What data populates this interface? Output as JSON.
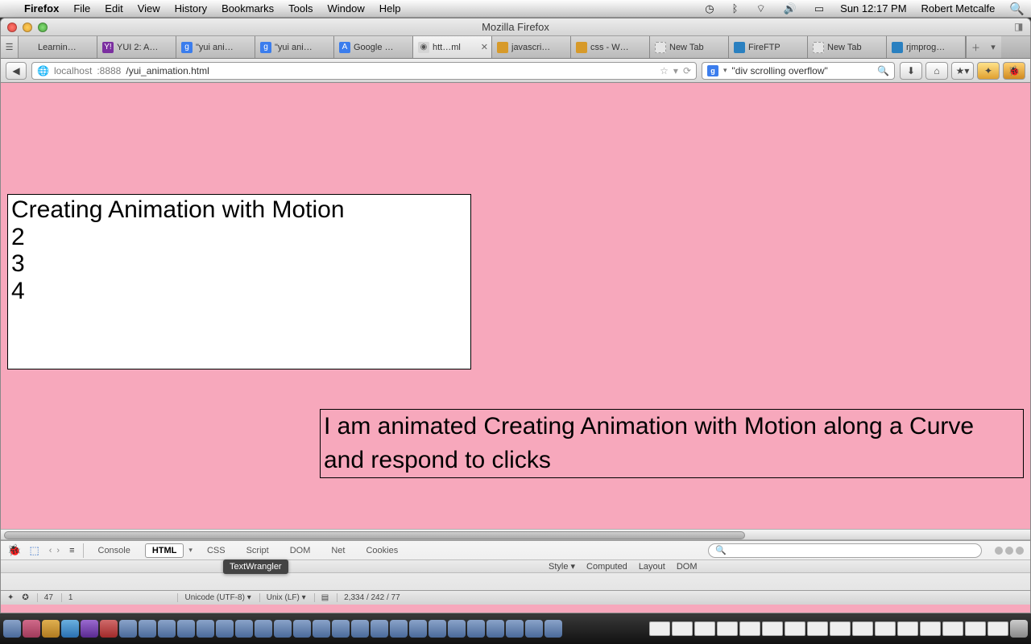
{
  "menubar": {
    "app": "Firefox",
    "items": [
      "File",
      "Edit",
      "View",
      "History",
      "Bookmarks",
      "Tools",
      "Window",
      "Help"
    ],
    "clock": "Sun 12:17 PM",
    "user": "Robert Metcalfe"
  },
  "window": {
    "title": "Mozilla Firefox"
  },
  "tabs": [
    {
      "label": "Learnin…",
      "fav_bg": "#c9c9c9",
      "fav_txt": ""
    },
    {
      "label": "YUI 2: A…",
      "fav_bg": "#7b2fa0",
      "fav_txt": "Y!"
    },
    {
      "label": "\"yui ani…",
      "fav_bg": "#3b7ded",
      "fav_txt": "g"
    },
    {
      "label": "\"yui ani…",
      "fav_bg": "#3b7ded",
      "fav_txt": "g"
    },
    {
      "label": "Google …",
      "fav_bg": "#3b7ded",
      "fav_txt": "A"
    },
    {
      "label": "htt…ml",
      "fav_bg": "#d0d0d0",
      "fav_txt": "",
      "active": true,
      "closable": true
    },
    {
      "label": "javascri…",
      "fav_bg": "#d79a2a",
      "fav_txt": ""
    },
    {
      "label": "css - W…",
      "fav_bg": "#d79a2a",
      "fav_txt": ""
    },
    {
      "label": "New Tab",
      "fav_bg": "#e5e5e5",
      "fav_txt": ""
    },
    {
      "label": "FireFTP",
      "fav_bg": "#2a80c0",
      "fav_txt": ""
    },
    {
      "label": "New Tab",
      "fav_bg": "#e5e5e5",
      "fav_txt": ""
    },
    {
      "label": "rjmprog…",
      "fav_bg": "#2a80c0",
      "fav_txt": ""
    }
  ],
  "url": {
    "host": "localhost",
    "port": ":8888",
    "path": "/yui_animation.html"
  },
  "search": {
    "engine": "g",
    "query": "\"div scrolling overflow\""
  },
  "page": {
    "box1_lines": [
      "Creating Animation with Motion",
      "2",
      "3",
      "4"
    ],
    "box2_text": "I am animated Creating Animation with Motion along a Curve and respond to clicks"
  },
  "firebug": {
    "panels": [
      "Console",
      "HTML",
      "CSS",
      "Script",
      "DOM",
      "Net",
      "Cookies"
    ],
    "active_panel": "HTML",
    "subpanels": [
      "Style",
      "Computed",
      "Layout",
      "DOM"
    ],
    "search_placeholder": ""
  },
  "statusbar": {
    "line_col": "47",
    "col2": "1",
    "encoding": "Unicode (UTF-8)",
    "lineend": "Unix (LF)",
    "pos": "2,334 / 242 / 77"
  },
  "tooltip": "TextWrangler"
}
